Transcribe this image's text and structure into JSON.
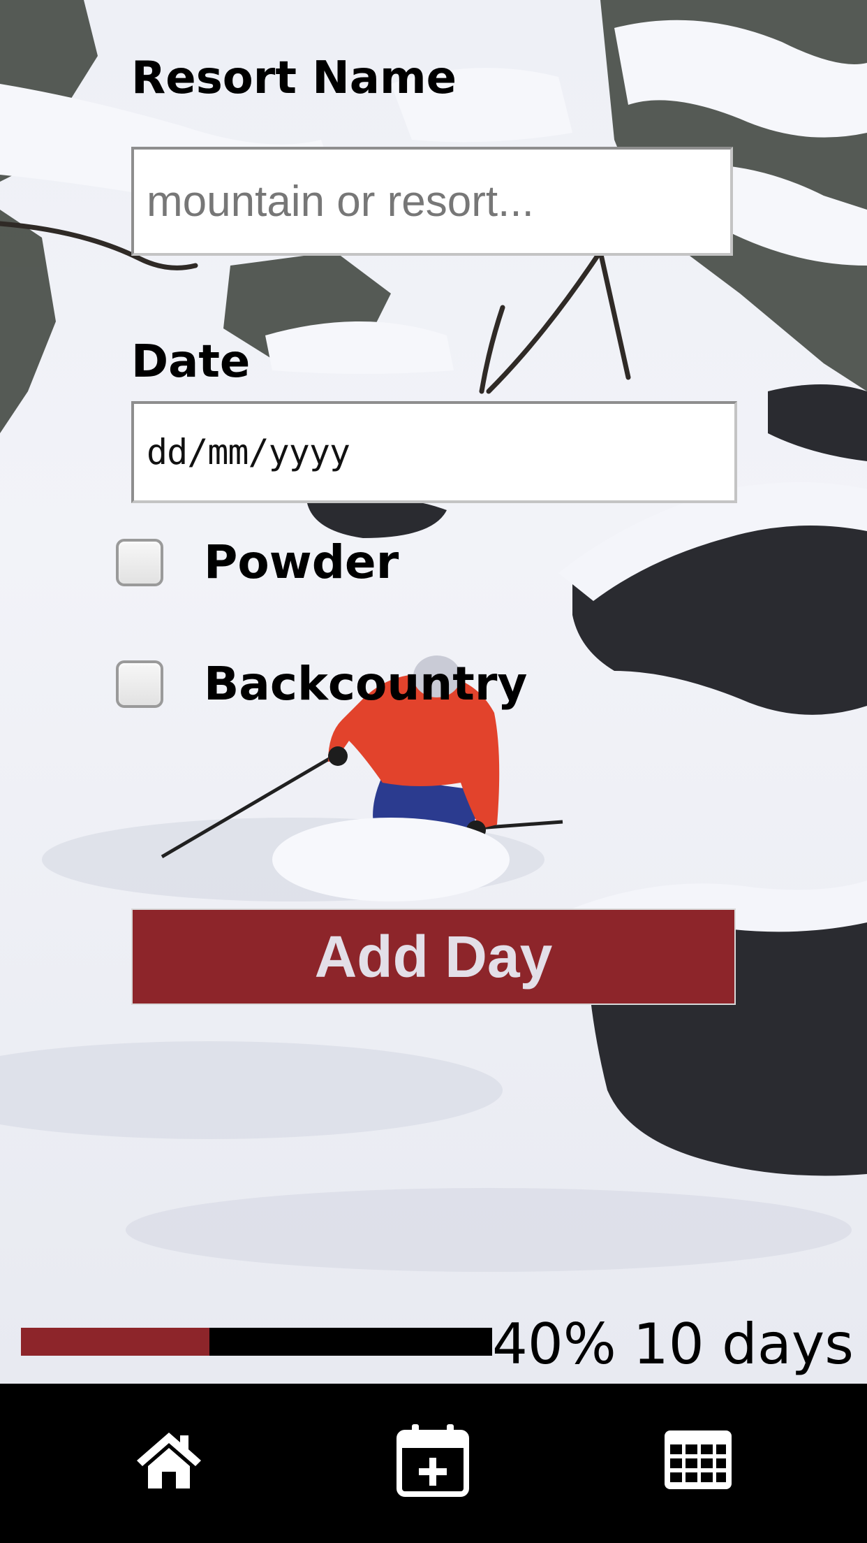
{
  "form": {
    "resort_label": "Resort Name",
    "resort_placeholder": "mountain or resort...",
    "date_label": "Date",
    "date_placeholder": "dd/mm/yyyy",
    "checkboxes": [
      {
        "label": "Powder",
        "checked": false
      },
      {
        "label": "Backcountry",
        "checked": false
      }
    ],
    "submit_label": "Add Day"
  },
  "progress": {
    "fraction": 0.4,
    "percent_text": "40%",
    "days_text": "10 days"
  },
  "nav": {
    "items": [
      {
        "icon": "home-icon"
      },
      {
        "icon": "calendar-add-icon"
      },
      {
        "icon": "calendar-grid-icon"
      }
    ]
  },
  "colors": {
    "accent": "#8d252a",
    "button_text": "#e3dfe8",
    "nav_background": "#000000",
    "nav_icon": "#ffffff"
  }
}
